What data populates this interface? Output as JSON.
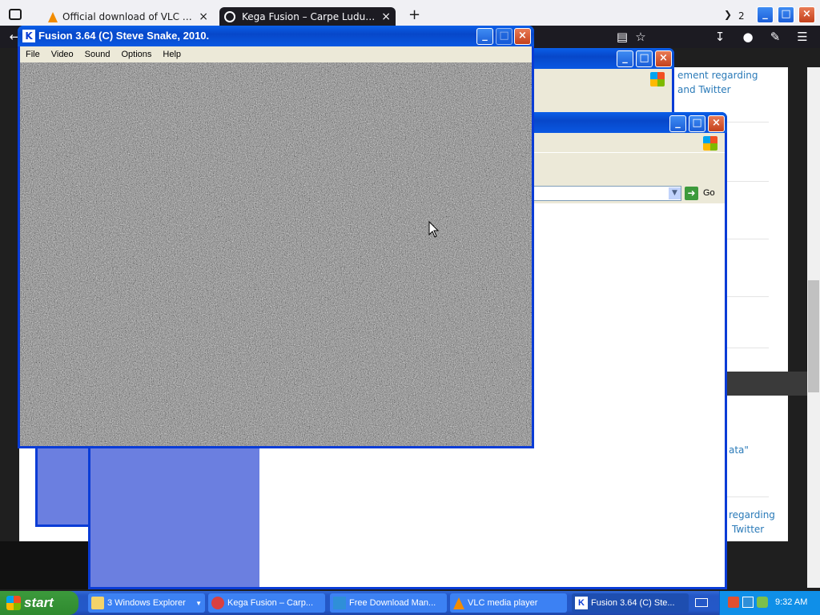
{
  "browser": {
    "tabs": [
      {
        "title": "Official download of VLC media pl",
        "close": "×"
      },
      {
        "title": "Kega Fusion – Carpe Ludum – Eidc",
        "close": "×"
      }
    ],
    "new_tab": "+",
    "tab_list_count": "2",
    "page_links": [
      "ement regarding",
      "and Twitter",
      "regarding",
      "Twitter",
      "ata\""
    ]
  },
  "ie_window_1": {
    "go_label": "Go"
  },
  "fusion": {
    "title": "Fusion 3.64 (C) Steve Snake, 2010.",
    "menu": [
      "File",
      "Video",
      "Sound",
      "Options",
      "Help"
    ]
  },
  "taskbar": {
    "start_label": "start",
    "items": [
      {
        "label": "3 Windows Explorer"
      },
      {
        "label": "Kega Fusion – Carp..."
      },
      {
        "label": "Free Download Man..."
      },
      {
        "label": "VLC media player"
      },
      {
        "label": "Fusion 3.64 (C) Ste..."
      }
    ],
    "clock": "9:32 AM"
  },
  "colors": {
    "xp_blue": "#0a3cd6",
    "taskbar": "#2457c6",
    "start_green": "#2f8a2f",
    "link": "#2a7ab8"
  }
}
